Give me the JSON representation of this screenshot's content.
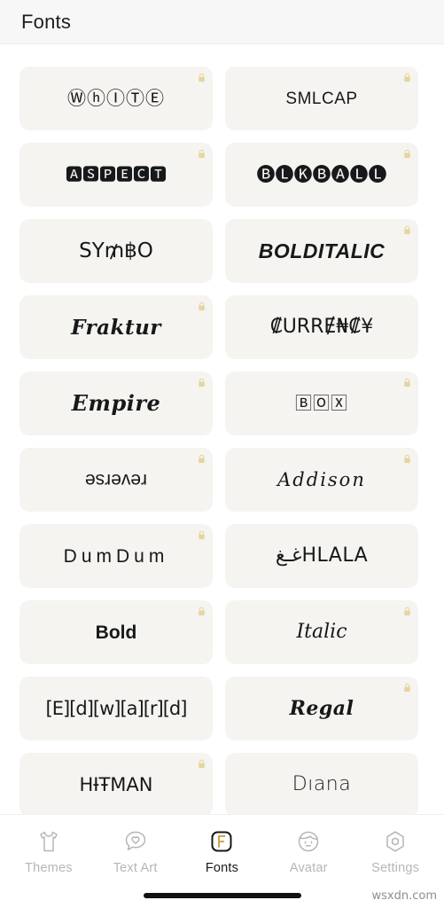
{
  "header": {
    "title": "Fonts"
  },
  "colors": {
    "page_background": "#ffffff",
    "header_background": "#f7f7f7",
    "card_background": "#f5f4f0",
    "text": "#17181a",
    "lock_gold": "#e2cf91",
    "tab_inactive": "#b6b6b6",
    "tab_active": "#18181a",
    "accent_gold": "#c8a84b"
  },
  "fonts_grid": {
    "lock_icon_name": "lock-icon",
    "cards": [
      {
        "id": "white",
        "label": "ⓌⓗⒾⓉⒺ",
        "plain": "WHITE",
        "style": "s-circled",
        "locked": true
      },
      {
        "id": "smlcap",
        "label": "SMLCAP",
        "plain": "SMLCAP",
        "style": "s-smlcap",
        "locked": true
      },
      {
        "id": "aspect",
        "label": "🅰🆂🅿🅴🅲🆃",
        "plain": "ASPECT",
        "style": "s-squares",
        "locked": true
      },
      {
        "id": "blkball",
        "label": "🅑🅛🅚🅑🅐🅛🅛",
        "plain": "BLKBALL",
        "style": "s-blkball",
        "locked": true
      },
      {
        "id": "symbo",
        "label": "SY₥฿O",
        "plain": "SYMBO",
        "style": "s-symbo",
        "locked": false
      },
      {
        "id": "bolditalic",
        "label": "BOLDITALIC",
        "plain": "BOLDITALIC",
        "style": "s-bolditalic",
        "locked": true
      },
      {
        "id": "fraktur",
        "label": "Fraktur",
        "plain": "Fraktur",
        "style": "s-fraktur",
        "locked": true
      },
      {
        "id": "currency",
        "label": "₡URRɆ₦₡¥",
        "plain": "CURRENCY",
        "style": "s-currency",
        "locked": false
      },
      {
        "id": "empire",
        "label": "Empire",
        "plain": "Empire",
        "style": "s-empire",
        "locked": true
      },
      {
        "id": "box",
        "label": "🄱🄾🅇",
        "plain": "BOX",
        "style": "s-box",
        "locked": true
      },
      {
        "id": "reverse",
        "label": "reverse",
        "plain": "reverse",
        "style": "s-reverse",
        "locked": true
      },
      {
        "id": "addison",
        "label": "Addison",
        "plain": "Addison",
        "style": "s-addison",
        "locked": true
      },
      {
        "id": "dumdum",
        "label": "DumDum",
        "plain": "DumDum",
        "style": "s-dumdum",
        "locked": true
      },
      {
        "id": "hlala",
        "label": "غـغHLALA",
        "plain": "HLALA",
        "style": "s-hlala",
        "locked": false
      },
      {
        "id": "bold",
        "label": "Bold",
        "plain": "Bold",
        "style": "s-bold",
        "locked": true
      },
      {
        "id": "italic",
        "label": "Italic",
        "plain": "Italic",
        "style": "s-italic",
        "locked": true
      },
      {
        "id": "edward",
        "label": "[E][d][w][a][r][d]",
        "plain": "Edward",
        "style": "s-bracket",
        "locked": false
      },
      {
        "id": "regal",
        "label": "Regal",
        "plain": "Regal",
        "style": "s-regal",
        "locked": true
      },
      {
        "id": "hitman",
        "label": "HƗŦMAN",
        "plain": "HITMAN",
        "style": "s-hitman",
        "locked": true
      },
      {
        "id": "diana",
        "label": "Dıana",
        "plain": "Diana",
        "style": "s-diana",
        "locked": false
      }
    ]
  },
  "tabbar": {
    "items": [
      {
        "id": "themes",
        "label": "Themes",
        "icon": "tshirt-icon",
        "active": false
      },
      {
        "id": "textart",
        "label": "Text Art",
        "icon": "heart-bubble-icon",
        "active": false
      },
      {
        "id": "fonts",
        "label": "Fonts",
        "icon": "font-f-icon",
        "active": true
      },
      {
        "id": "avatar",
        "label": "Avatar",
        "icon": "face-icon",
        "active": false
      },
      {
        "id": "settings",
        "label": "Settings",
        "icon": "hexagon-gear-icon",
        "active": false
      }
    ]
  },
  "watermark": {
    "text": "wsxdn.com"
  }
}
